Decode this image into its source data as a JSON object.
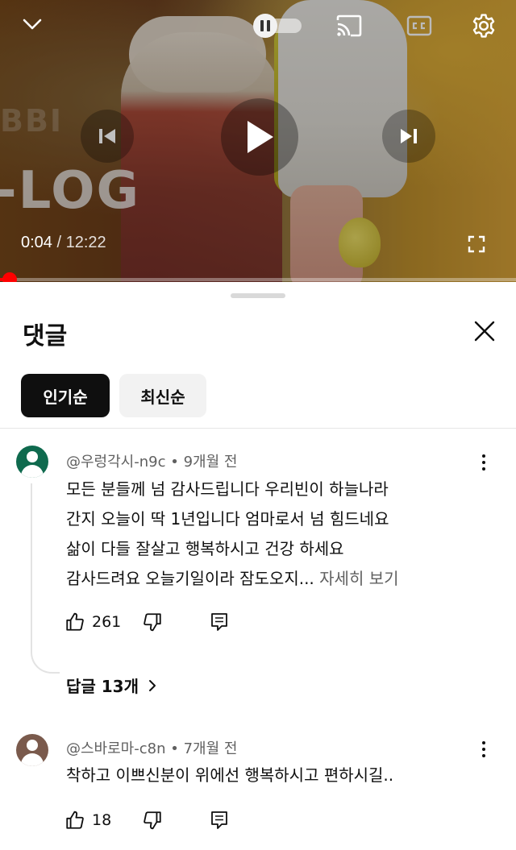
{
  "player": {
    "time_current": "0:04",
    "time_separator": " / ",
    "time_total": "12:22",
    "progress_fraction": 0.0054,
    "autoplay": "paused",
    "overlay_text_top": "BBI",
    "overlay_text_main": "-LOG",
    "icons": {
      "collapse": "chevron-down-icon",
      "autoplay": "pause-icon",
      "cast": "cast-icon",
      "captions": "cc-icon",
      "settings": "gear-icon",
      "previous": "skip-previous-icon",
      "play": "play-icon",
      "next": "skip-next-icon",
      "fullscreen": "fullscreen-icon"
    },
    "colors": {
      "progress": "#ff0000"
    }
  },
  "comments_panel": {
    "title": "댓글",
    "close_icon": "close-icon",
    "sort_chips": [
      {
        "label": "인기순",
        "selected": true
      },
      {
        "label": "최신순",
        "selected": false
      }
    ],
    "comments": [
      {
        "author": "@우렁각시-n9c",
        "separator": " • ",
        "time": "9개월 전",
        "lines": [
          "모든 분들께 넘 감사드립니다 우리빈이 하늘나라",
          "간지 오늘이 딱 1년입니다 엄마로서 넘 힘드네요",
          "삶이 다들 잘살고 행복하시고 건강 하세요",
          "감사드려요 오늘기일이라 잠도오지..."
        ],
        "read_more": " 자세히 보기",
        "likes": "261",
        "replies_label": "답글 13개",
        "avatar_color": "#0f6a4e"
      },
      {
        "author": "@스바로마-c8n",
        "separator": " • ",
        "time": "7개월 전",
        "lines": [
          "착하고 이쁘신분이 위에선 행복하시고 편하시길.."
        ],
        "likes": "18",
        "avatar_color": "#7a5a4c"
      }
    ]
  }
}
